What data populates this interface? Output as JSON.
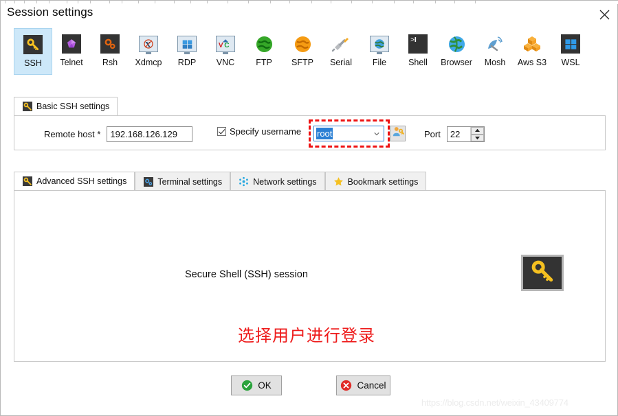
{
  "dialog": {
    "title": "Session settings",
    "close_label": "×"
  },
  "protocols": {
    "selected": "SSH",
    "items": [
      {
        "label": "SSH",
        "icon": "key-icon"
      },
      {
        "label": "Telnet",
        "icon": "telnet-gem-icon"
      },
      {
        "label": "Rsh",
        "icon": "rsh-gears-icon"
      },
      {
        "label": "Xdmcp",
        "icon": "xdmcp-monitor-icon"
      },
      {
        "label": "RDP",
        "icon": "rdp-monitor-icon"
      },
      {
        "label": "VNC",
        "icon": "vnc-monitor-icon"
      },
      {
        "label": "FTP",
        "icon": "ftp-globe-green-icon"
      },
      {
        "label": "SFTP",
        "icon": "sftp-globe-orange-icon"
      },
      {
        "label": "Serial",
        "icon": "serial-plug-icon"
      },
      {
        "label": "File",
        "icon": "file-monitor-globe-icon"
      },
      {
        "label": "Shell",
        "icon": "shell-terminal-icon"
      },
      {
        "label": "Browser",
        "icon": "browser-globe-icon"
      },
      {
        "label": "Mosh",
        "icon": "mosh-satellite-icon"
      },
      {
        "label": "Aws S3",
        "icon": "aws-s3-cubes-icon"
      },
      {
        "label": "WSL",
        "icon": "wsl-windows-icon"
      }
    ]
  },
  "basic_tab": {
    "label": "Basic SSH settings",
    "icon": "key-icon",
    "remote_host": {
      "label": "Remote host *",
      "value": "192.168.126.129",
      "placeholder": ""
    },
    "specify_username": {
      "label": "Specify username",
      "checked": true
    },
    "username": {
      "value": "root",
      "caret_icon": "chevron-down-icon",
      "picker_icon": "user-key-icon",
      "highlight_color": "#ee1111"
    },
    "port": {
      "label": "Port",
      "value": "22",
      "up_icon": "spinner-up-icon",
      "down_icon": "spinner-down-icon"
    }
  },
  "settings_tabs": {
    "active": "Advanced SSH settings",
    "items": [
      {
        "label": "Advanced SSH settings",
        "icon": "key-icon"
      },
      {
        "label": "Terminal settings",
        "icon": "terminal-gear-icon"
      },
      {
        "label": "Network settings",
        "icon": "network-nodes-icon"
      },
      {
        "label": "Bookmark settings",
        "icon": "star-icon"
      }
    ]
  },
  "panel": {
    "session_text": "Secure Shell (SSH) session",
    "annotation": "选择用户进行登录",
    "annotation_color": "#ee1c1c",
    "badge_icon": "key-icon"
  },
  "footer": {
    "ok": {
      "label": "OK",
      "icon": "check-circle-green-icon"
    },
    "cancel": {
      "label": "Cancel",
      "icon": "cross-circle-red-icon"
    }
  },
  "watermark": {
    "text": "https://blog.csdn.net/weixin_43409774"
  }
}
